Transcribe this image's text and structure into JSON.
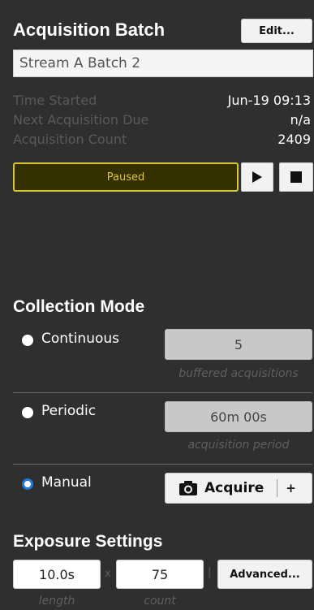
{
  "acquisition": {
    "title": "Acquisition Batch",
    "edit_label": "Edit...",
    "batch_name": "Stream A Batch 2",
    "stats": [
      {
        "label": "Time Started",
        "value": "Jun-19 09:13"
      },
      {
        "label": "Next Acquisition Due",
        "value": "n/a"
      },
      {
        "label": "Acquisition Count",
        "value": "2409"
      }
    ],
    "status": "Paused",
    "status_color": "#d8c640"
  },
  "collection": {
    "title": "Collection Mode",
    "continuous": {
      "label": "Continuous",
      "value": "5",
      "hint": "buffered acquisitions",
      "selected": false
    },
    "periodic": {
      "label": "Periodic",
      "value": "60m 00s",
      "hint": "acquisition period",
      "selected": false
    },
    "manual": {
      "label": "Manual",
      "acquire_label": "Acquire",
      "plus_label": "+",
      "selected": true,
      "icon": "camera-icon"
    },
    "accent": "#1e7ad6"
  },
  "exposure": {
    "title": "Exposure Settings",
    "length_value": "10.0s",
    "length_hint": "length",
    "times_label": "x",
    "count_value": "75",
    "count_hint": "count",
    "bar_label": "|",
    "advanced_label": "Advanced..."
  }
}
